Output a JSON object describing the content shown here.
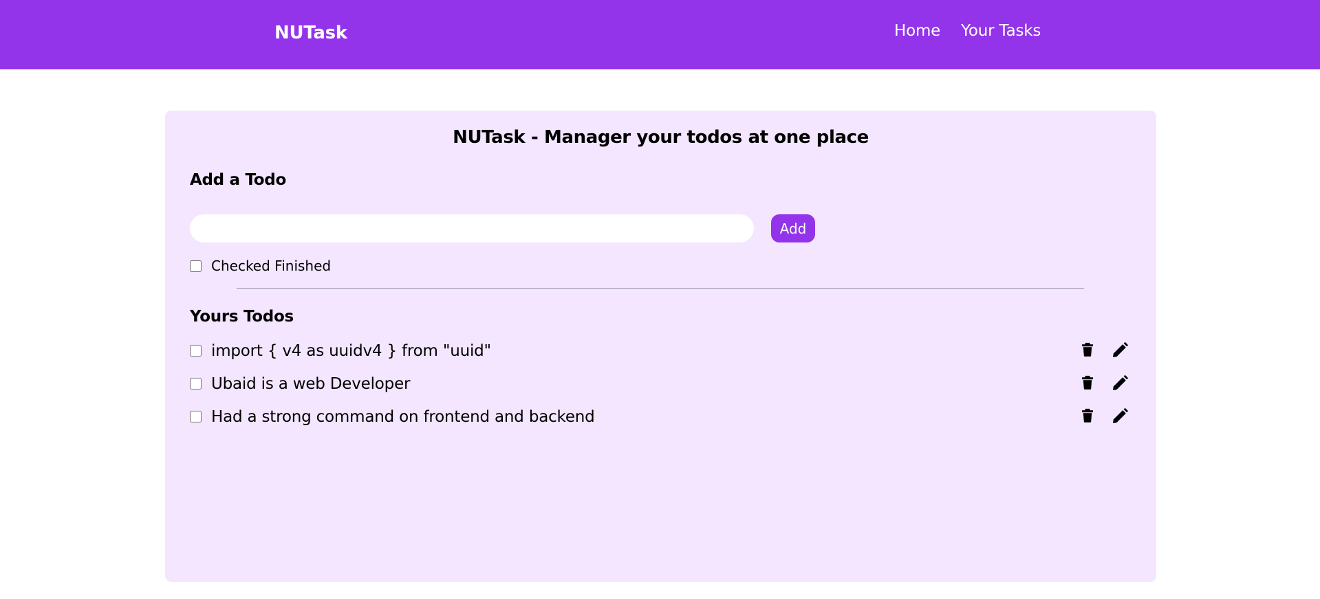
{
  "header": {
    "brand": "NUTask",
    "nav": [
      {
        "label": "Home"
      },
      {
        "label": "Your Tasks"
      }
    ]
  },
  "card": {
    "title": "NUTask - Manager your todos at one place",
    "add_section": {
      "heading": "Add a Todo",
      "input_value": "",
      "add_label": "Add",
      "finished_label": "Checked Finished",
      "finished_checked": false
    },
    "list_section": {
      "heading": "Yours Todos",
      "todos": [
        {
          "text": "import { v4 as uuidv4 } from \"uuid\"",
          "done": false
        },
        {
          "text": "Ubaid is a web Developer",
          "done": false
        },
        {
          "text": "Had a strong command on frontend and backend",
          "done": false
        }
      ]
    }
  },
  "icons": {
    "delete": "trash-icon",
    "edit": "pencil-icon"
  },
  "colors": {
    "brand": "#9333ea",
    "card_background": "#f3e6fe",
    "page_background": "#ffffff"
  }
}
